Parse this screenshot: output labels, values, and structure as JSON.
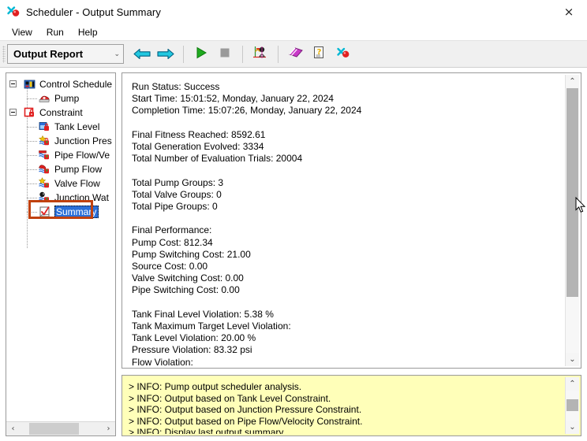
{
  "window": {
    "title": "Scheduler - Output Summary",
    "app_icon": "scheduler-icon",
    "close_label": "×"
  },
  "menubar": {
    "items": [
      {
        "label": "View"
      },
      {
        "label": "Run"
      },
      {
        "label": "Help"
      }
    ]
  },
  "toolbar": {
    "report_select": {
      "value": "Output Report",
      "arrow": "⌄"
    },
    "buttons": [
      {
        "name": "back-arrow-button",
        "icon": "arrow-left-icon",
        "title": "Back"
      },
      {
        "name": "forward-arrow-button",
        "icon": "arrow-right-icon",
        "title": "Forward"
      },
      {
        "name": "run-button",
        "icon": "play-icon",
        "title": "Run"
      },
      {
        "name": "stop-button",
        "icon": "stop-icon",
        "title": "Stop"
      },
      {
        "name": "analysis-button",
        "icon": "analysis-icon",
        "title": "Analysis"
      },
      {
        "name": "manual-button",
        "icon": "book-icon",
        "title": "Manual"
      },
      {
        "name": "help-button",
        "icon": "help-page-icon",
        "title": "Help"
      },
      {
        "name": "about-button",
        "icon": "scheduler-icon",
        "title": "About"
      }
    ]
  },
  "tree": {
    "nodes": [
      {
        "label": "Control Schedule",
        "icon": "control-schedule-icon",
        "depth": 0,
        "expander": true,
        "selected": false
      },
      {
        "label": "Pump",
        "icon": "pump-icon",
        "depth": 1,
        "expander": false,
        "selected": false
      },
      {
        "label": "Constraint",
        "icon": "constraint-lock-icon",
        "depth": 0,
        "expander": true,
        "selected": false
      },
      {
        "label": "Tank Level",
        "icon": "tank-level-icon",
        "depth": 1,
        "expander": false,
        "selected": false
      },
      {
        "label": "Junction Pres",
        "icon": "junction-pressure-icon",
        "depth": 1,
        "expander": false,
        "selected": false
      },
      {
        "label": "Pipe Flow/Ve",
        "icon": "pipe-flow-velocity-icon",
        "depth": 1,
        "expander": false,
        "selected": false
      },
      {
        "label": "Pump Flow",
        "icon": "pump-flow-icon",
        "depth": 1,
        "expander": false,
        "selected": false
      },
      {
        "label": "Valve Flow",
        "icon": "valve-flow-icon",
        "depth": 1,
        "expander": false,
        "selected": false
      },
      {
        "label": "Junction Wat",
        "icon": "junction-water-age-icon",
        "depth": 1,
        "expander": false,
        "selected": false
      },
      {
        "label": "Summary",
        "icon": "summary-check-icon",
        "depth": 1,
        "expander": false,
        "selected": true
      }
    ],
    "hscroll": {
      "left_arrow": "‹",
      "right_arrow": "›"
    }
  },
  "report": {
    "text": "Run Status: Success\nStart Time: 15:01:52, Monday, January 22, 2024\nCompletion Time: 15:07:26, Monday, January 22, 2024\n\nFinal Fitness Reached: 8592.61\nTotal Generation Evolved: 3334\nTotal Number of Evaluation Trials: 20004\n\nTotal Pump Groups: 3\nTotal Valve Groups: 0\nTotal Pipe Groups: 0\n\nFinal Performance:\nPump Cost: 812.34\nPump Switching Cost: 21.00\nSource Cost: 0.00\nValve Switching Cost: 0.00\nPipe Switching Cost: 0.00\n\nTank Final Level Violation: 5.38 %\nTank Maximum Target Level Violation:\nTank Level Violation: 20.00 %\nPressure Violation: 83.32 psi\nFlow Violation:\nVelocity Violation:\nWater Age Violation:",
    "scroll": {
      "up_arrow": "⌃",
      "down_arrow": "⌄"
    }
  },
  "info": {
    "text": "> INFO: Pump output scheduler analysis.\n> INFO: Output based on Tank Level Constraint.\n> INFO: Output based on Junction Pressure Constraint.\n> INFO: Output based on Pipe Flow/Velocity Constraint.\n> INFO: Display last output summary",
    "scroll": {
      "up_arrow": "⌃",
      "down_arrow": "⌄"
    }
  },
  "colors": {
    "selection_blue": "#2b6fd8",
    "highlight_box": "#c0410f",
    "info_background": "#ffffb9",
    "toolbar_background": "#f0f0f0"
  }
}
